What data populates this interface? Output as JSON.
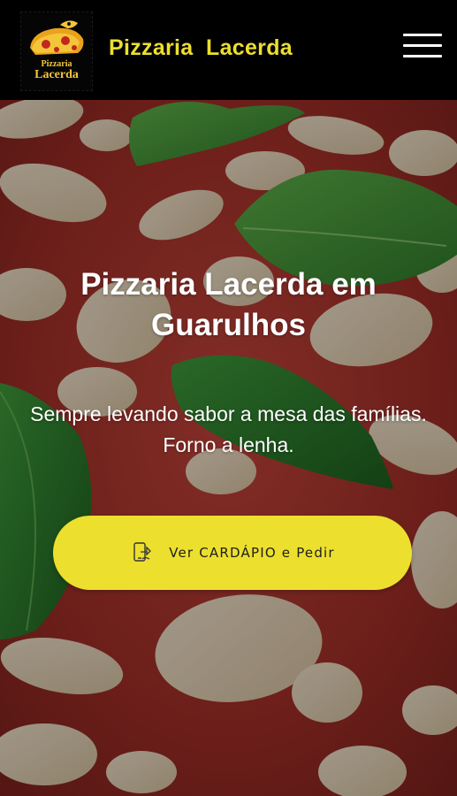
{
  "header": {
    "logo_text_line1": "Pizzaria",
    "logo_text_line2": "Lacerda",
    "brand": "Pizzaria  Lacerda",
    "menu_icon": "hamburger-menu-icon"
  },
  "hero": {
    "title": "Pizzaria Lacerda em Guarulhos",
    "subtitle": "Sempre levando sabor a mesa das famílias. Forno a lenha.",
    "cta_label": "Ver CARDÁPIO e Pedir",
    "cta_icon": "mobile-order-icon"
  },
  "colors": {
    "header_bg": "#000000",
    "accent_yellow": "#ecdf2e",
    "text_white": "#ffffff"
  }
}
